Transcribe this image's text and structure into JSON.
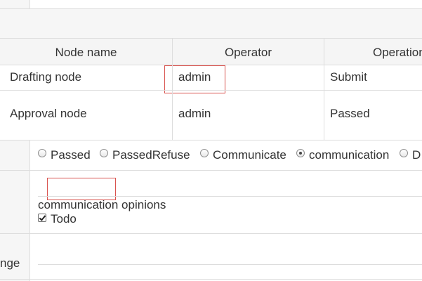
{
  "table": {
    "headers": [
      "Node name",
      "Operator",
      "Operation"
    ],
    "rows": [
      {
        "node": "Drafting node",
        "operator": "admin",
        "operation": "Submit"
      },
      {
        "node": "Approval node",
        "operator": "admin",
        "operation": "Passed"
      }
    ]
  },
  "decision": {
    "options": [
      {
        "label": "Passed",
        "selected": false
      },
      {
        "label": "PassedRefuse",
        "selected": false
      },
      {
        "label": "Communicate",
        "selected": false
      },
      {
        "label": "communication",
        "selected": true
      },
      {
        "label": "D",
        "selected": false
      }
    ]
  },
  "communication": {
    "opinions_label": "communication opinions",
    "todo_label": "Todo",
    "todo_checked": true
  },
  "left_labels": {
    "change_partial": "nge"
  }
}
